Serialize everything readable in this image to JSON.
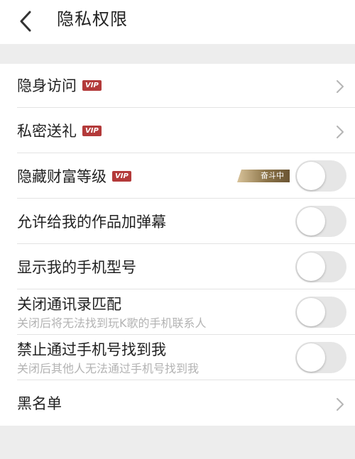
{
  "header": {
    "back_icon": "chevron-left-icon",
    "title": "隐私权限"
  },
  "items": [
    {
      "label": "隐身访问",
      "badge": "VIP",
      "control": "chevron"
    },
    {
      "label": "私密送礼",
      "badge": "VIP",
      "control": "chevron"
    },
    {
      "label": "隐藏财富等级",
      "badge": "VIP",
      "tag": "奋斗中",
      "control": "toggle",
      "on": false
    },
    {
      "label": "允许给我的作品加弹幕",
      "control": "toggle",
      "on": false
    },
    {
      "label": "显示我的手机型号",
      "control": "toggle",
      "on": false
    },
    {
      "label": "关闭通讯录匹配",
      "sublabel": "关闭后将无法找到玩K歌的手机联系人",
      "control": "toggle",
      "on": false
    },
    {
      "label": "禁止通过手机号找到我",
      "sublabel": "关闭后其他人无法通过手机号找到我",
      "control": "toggle",
      "on": false
    },
    {
      "label": "黑名单",
      "control": "chevron"
    }
  ],
  "colors": {
    "vip_badge": "#b33a3a",
    "toggle_off": "#e6e6e6",
    "background": "#ededed",
    "sublabel": "#b3b3b3"
  }
}
